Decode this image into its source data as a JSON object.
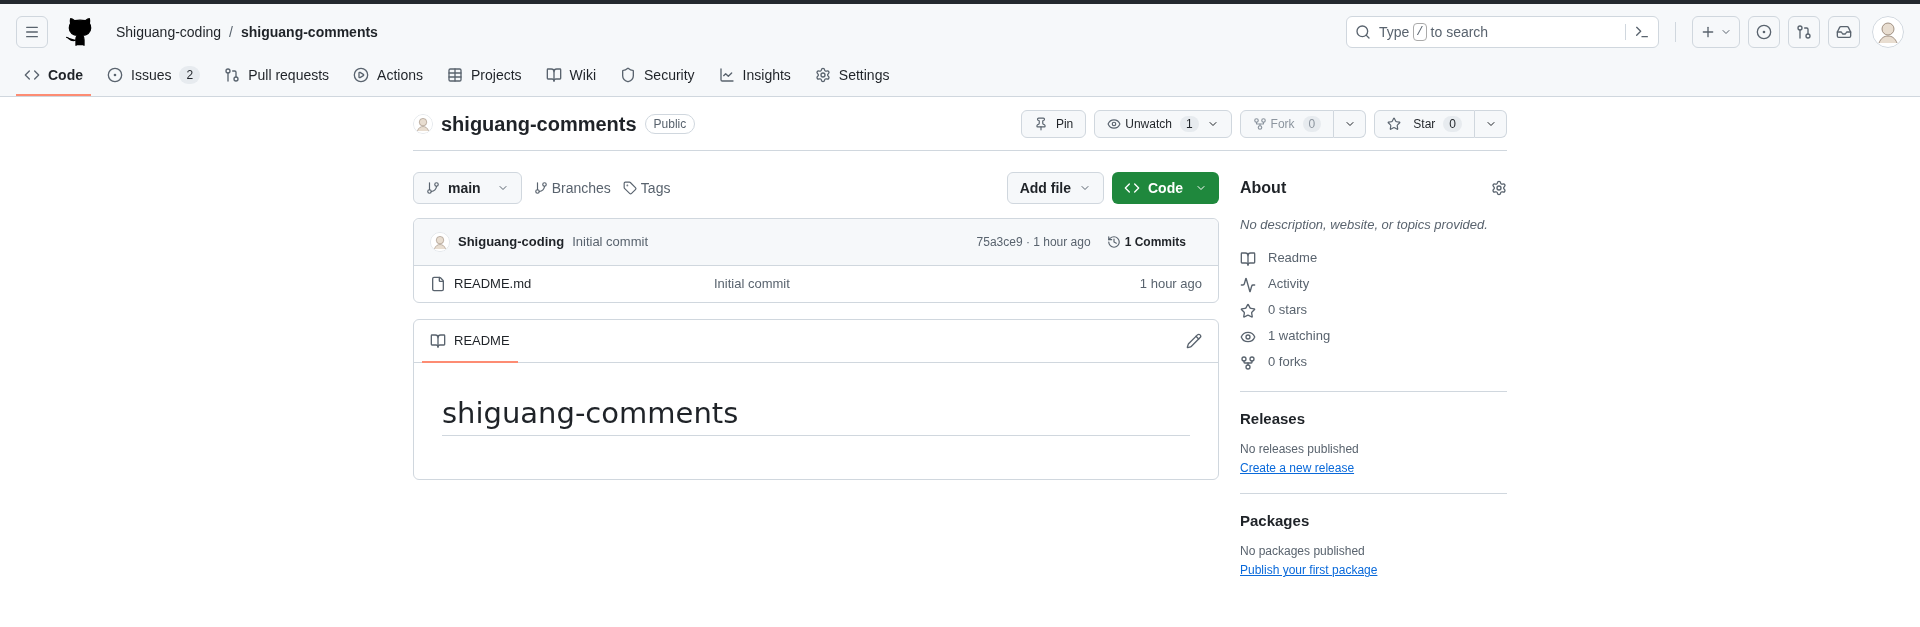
{
  "header": {
    "owner": "Shiguang-coding",
    "separator": "/",
    "repo": "shiguang-comments",
    "search": {
      "placeholder_before": "Type",
      "key": "/",
      "placeholder_after": "to search"
    }
  },
  "tabs": [
    {
      "label": "Code",
      "selected": true
    },
    {
      "label": "Issues",
      "count": "2",
      "selected": false
    },
    {
      "label": "Pull requests",
      "selected": false
    },
    {
      "label": "Actions",
      "selected": false
    },
    {
      "label": "Projects",
      "selected": false
    },
    {
      "label": "Wiki",
      "selected": false
    },
    {
      "label": "Security",
      "selected": false
    },
    {
      "label": "Insights",
      "selected": false
    },
    {
      "label": "Settings",
      "selected": false
    }
  ],
  "repo_header": {
    "name": "shiguang-comments",
    "visibility": "Public",
    "pin": "Pin",
    "unwatch": {
      "label": "Unwatch",
      "count": "1"
    },
    "fork": {
      "label": "Fork",
      "count": "0",
      "disabled": true
    },
    "star": {
      "label": "Star",
      "count": "0"
    }
  },
  "toolbar": {
    "branch": "main",
    "branches": "Branches",
    "tags": "Tags",
    "add_file": "Add file",
    "code": "Code"
  },
  "commit": {
    "author": "Shiguang-coding",
    "message": "Initial commit",
    "meta": "75a3ce9 · 1 hour ago",
    "commits": "1 Commits"
  },
  "files": [
    {
      "name": "README.md",
      "message": "Initial commit",
      "age": "1 hour ago"
    }
  ],
  "readme": {
    "tab": "README",
    "heading": "shiguang-comments"
  },
  "about": {
    "title": "About",
    "description": "No description, website, or topics provided.",
    "items": [
      {
        "label": "Readme"
      },
      {
        "label": "Activity"
      },
      {
        "label": "0 stars"
      },
      {
        "label": "1 watching"
      },
      {
        "label": "0 forks"
      }
    ]
  },
  "releases": {
    "title": "Releases",
    "note": "No releases published",
    "link": "Create a new release"
  },
  "packages": {
    "title": "Packages",
    "note": "No packages published",
    "link": "Publish your first package"
  }
}
